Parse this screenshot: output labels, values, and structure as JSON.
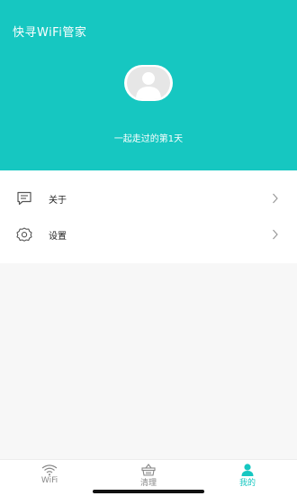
{
  "header": {
    "title": "快寻WiFi管家",
    "subtitle": "一起走过的第1天"
  },
  "menu": {
    "items": [
      {
        "label": "关于",
        "icon": "message-icon"
      },
      {
        "label": "设置",
        "icon": "gear-icon"
      }
    ]
  },
  "tabbar": {
    "tabs": [
      {
        "label": "WiFi",
        "icon": "wifi-icon",
        "active": false
      },
      {
        "label": "清理",
        "icon": "basket-icon",
        "active": false
      },
      {
        "label": "我的",
        "icon": "user-icon",
        "active": true
      }
    ]
  },
  "colors": {
    "accent": "#16c7c1",
    "background": "#f7f7f7"
  }
}
